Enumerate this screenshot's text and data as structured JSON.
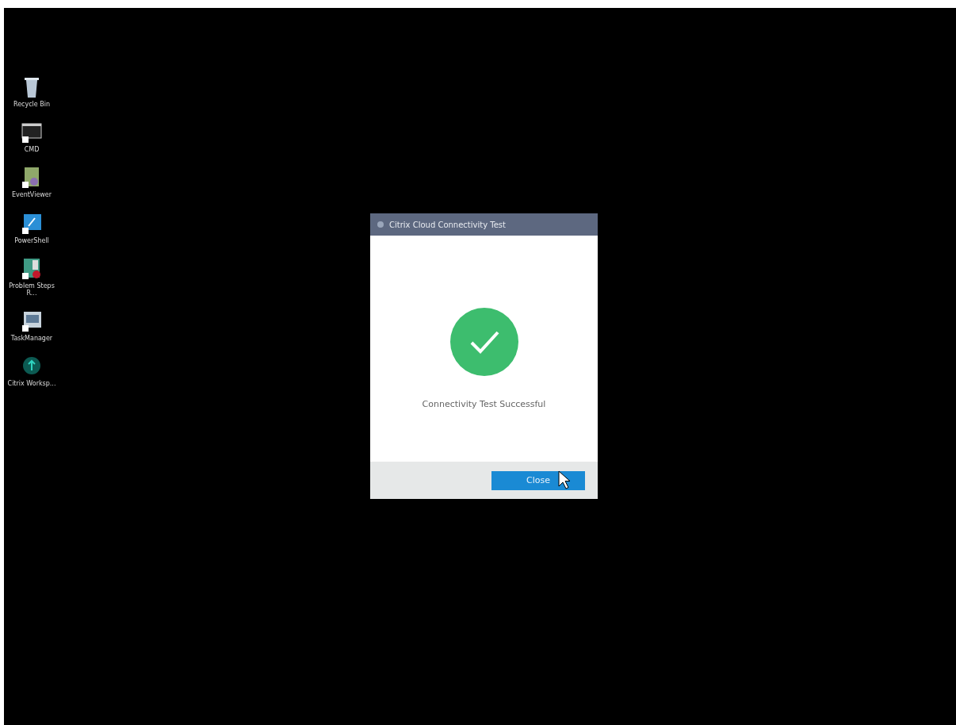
{
  "desktop_icons": [
    {
      "label": "Recycle Bin",
      "kind": "bin"
    },
    {
      "label": "CMD",
      "kind": "console"
    },
    {
      "label": "EventViewer",
      "kind": "viewer"
    },
    {
      "label": "PowerShell",
      "kind": "shell"
    },
    {
      "label": "Problem Steps R...",
      "kind": "steps"
    },
    {
      "label": "TaskManager",
      "kind": "tasks"
    },
    {
      "label": "Citrix Worksp...",
      "kind": "cloud"
    }
  ],
  "dialog": {
    "title": "Citrix Cloud Connectivity Test",
    "message": "Connectivity Test Successful",
    "buttons": [
      "Close"
    ]
  }
}
